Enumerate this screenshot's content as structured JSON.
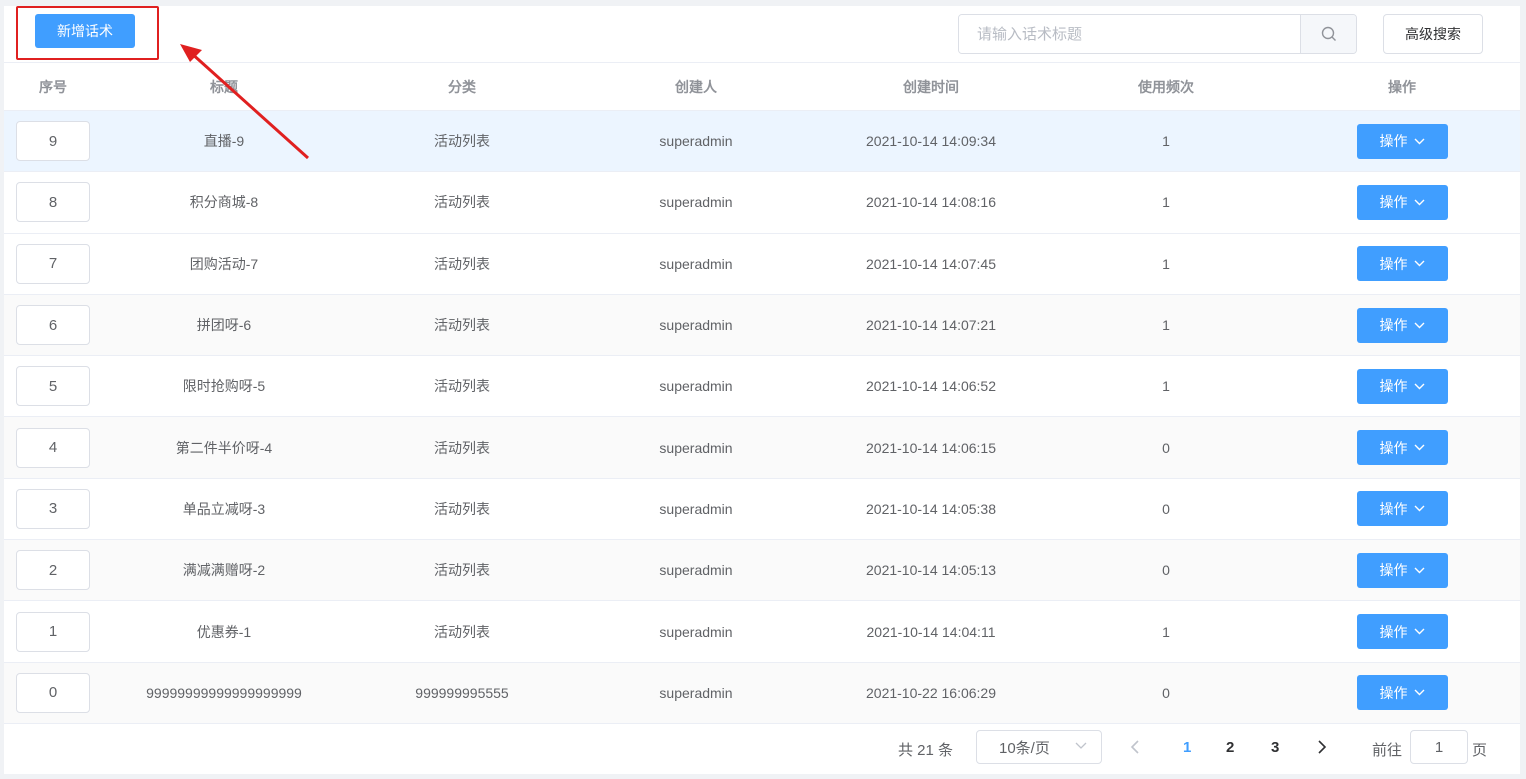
{
  "toolbar": {
    "add_label": "新增话术",
    "search_placeholder": "请输入话术标题",
    "advanced_search_label": "高级搜索"
  },
  "table": {
    "headers": [
      "序号",
      "标题",
      "分类",
      "创建人",
      "创建时间",
      "使用频次",
      "操作"
    ],
    "action_label": "操作",
    "rows": [
      {
        "seq": "9",
        "title": "直播-9",
        "category": "活动列表",
        "creator": "superadmin",
        "created": "2021-10-14 14:09:34",
        "uses": "1"
      },
      {
        "seq": "8",
        "title": "积分商城-8",
        "category": "活动列表",
        "creator": "superadmin",
        "created": "2021-10-14 14:08:16",
        "uses": "1"
      },
      {
        "seq": "7",
        "title": "团购活动-7",
        "category": "活动列表",
        "creator": "superadmin",
        "created": "2021-10-14 14:07:45",
        "uses": "1"
      },
      {
        "seq": "6",
        "title": "拼团呀-6",
        "category": "活动列表",
        "creator": "superadmin",
        "created": "2021-10-14 14:07:21",
        "uses": "1"
      },
      {
        "seq": "5",
        "title": "限时抢购呀-5",
        "category": "活动列表",
        "creator": "superadmin",
        "created": "2021-10-14 14:06:52",
        "uses": "1"
      },
      {
        "seq": "4",
        "title": "第二件半价呀-4",
        "category": "活动列表",
        "creator": "superadmin",
        "created": "2021-10-14 14:06:15",
        "uses": "0"
      },
      {
        "seq": "3",
        "title": "单品立减呀-3",
        "category": "活动列表",
        "creator": "superadmin",
        "created": "2021-10-14 14:05:38",
        "uses": "0"
      },
      {
        "seq": "2",
        "title": "满减满赠呀-2",
        "category": "活动列表",
        "creator": "superadmin",
        "created": "2021-10-14 14:05:13",
        "uses": "0"
      },
      {
        "seq": "1",
        "title": "优惠券-1",
        "category": "活动列表",
        "creator": "superadmin",
        "created": "2021-10-14 14:04:11",
        "uses": "1"
      },
      {
        "seq": "0",
        "title": "99999999999999999999",
        "category": "999999995555",
        "creator": "superadmin",
        "created": "2021-10-22 16:06:29",
        "uses": "0"
      }
    ]
  },
  "pagination": {
    "total_label": "共 21 条",
    "page_size": "10条/页",
    "pages": [
      "1",
      "2",
      "3"
    ],
    "current_page": "1",
    "goto_label": "前往",
    "goto_value": "1",
    "page_unit": "页"
  },
  "colors": {
    "primary": "#409eff",
    "annotation": "#e02020",
    "hover_row": "#ecf5ff"
  },
  "icons": [
    "search-icon",
    "chevron-down-icon",
    "chevron-left-icon",
    "chevron-right-icon",
    "annotation-arrow-icon"
  ]
}
